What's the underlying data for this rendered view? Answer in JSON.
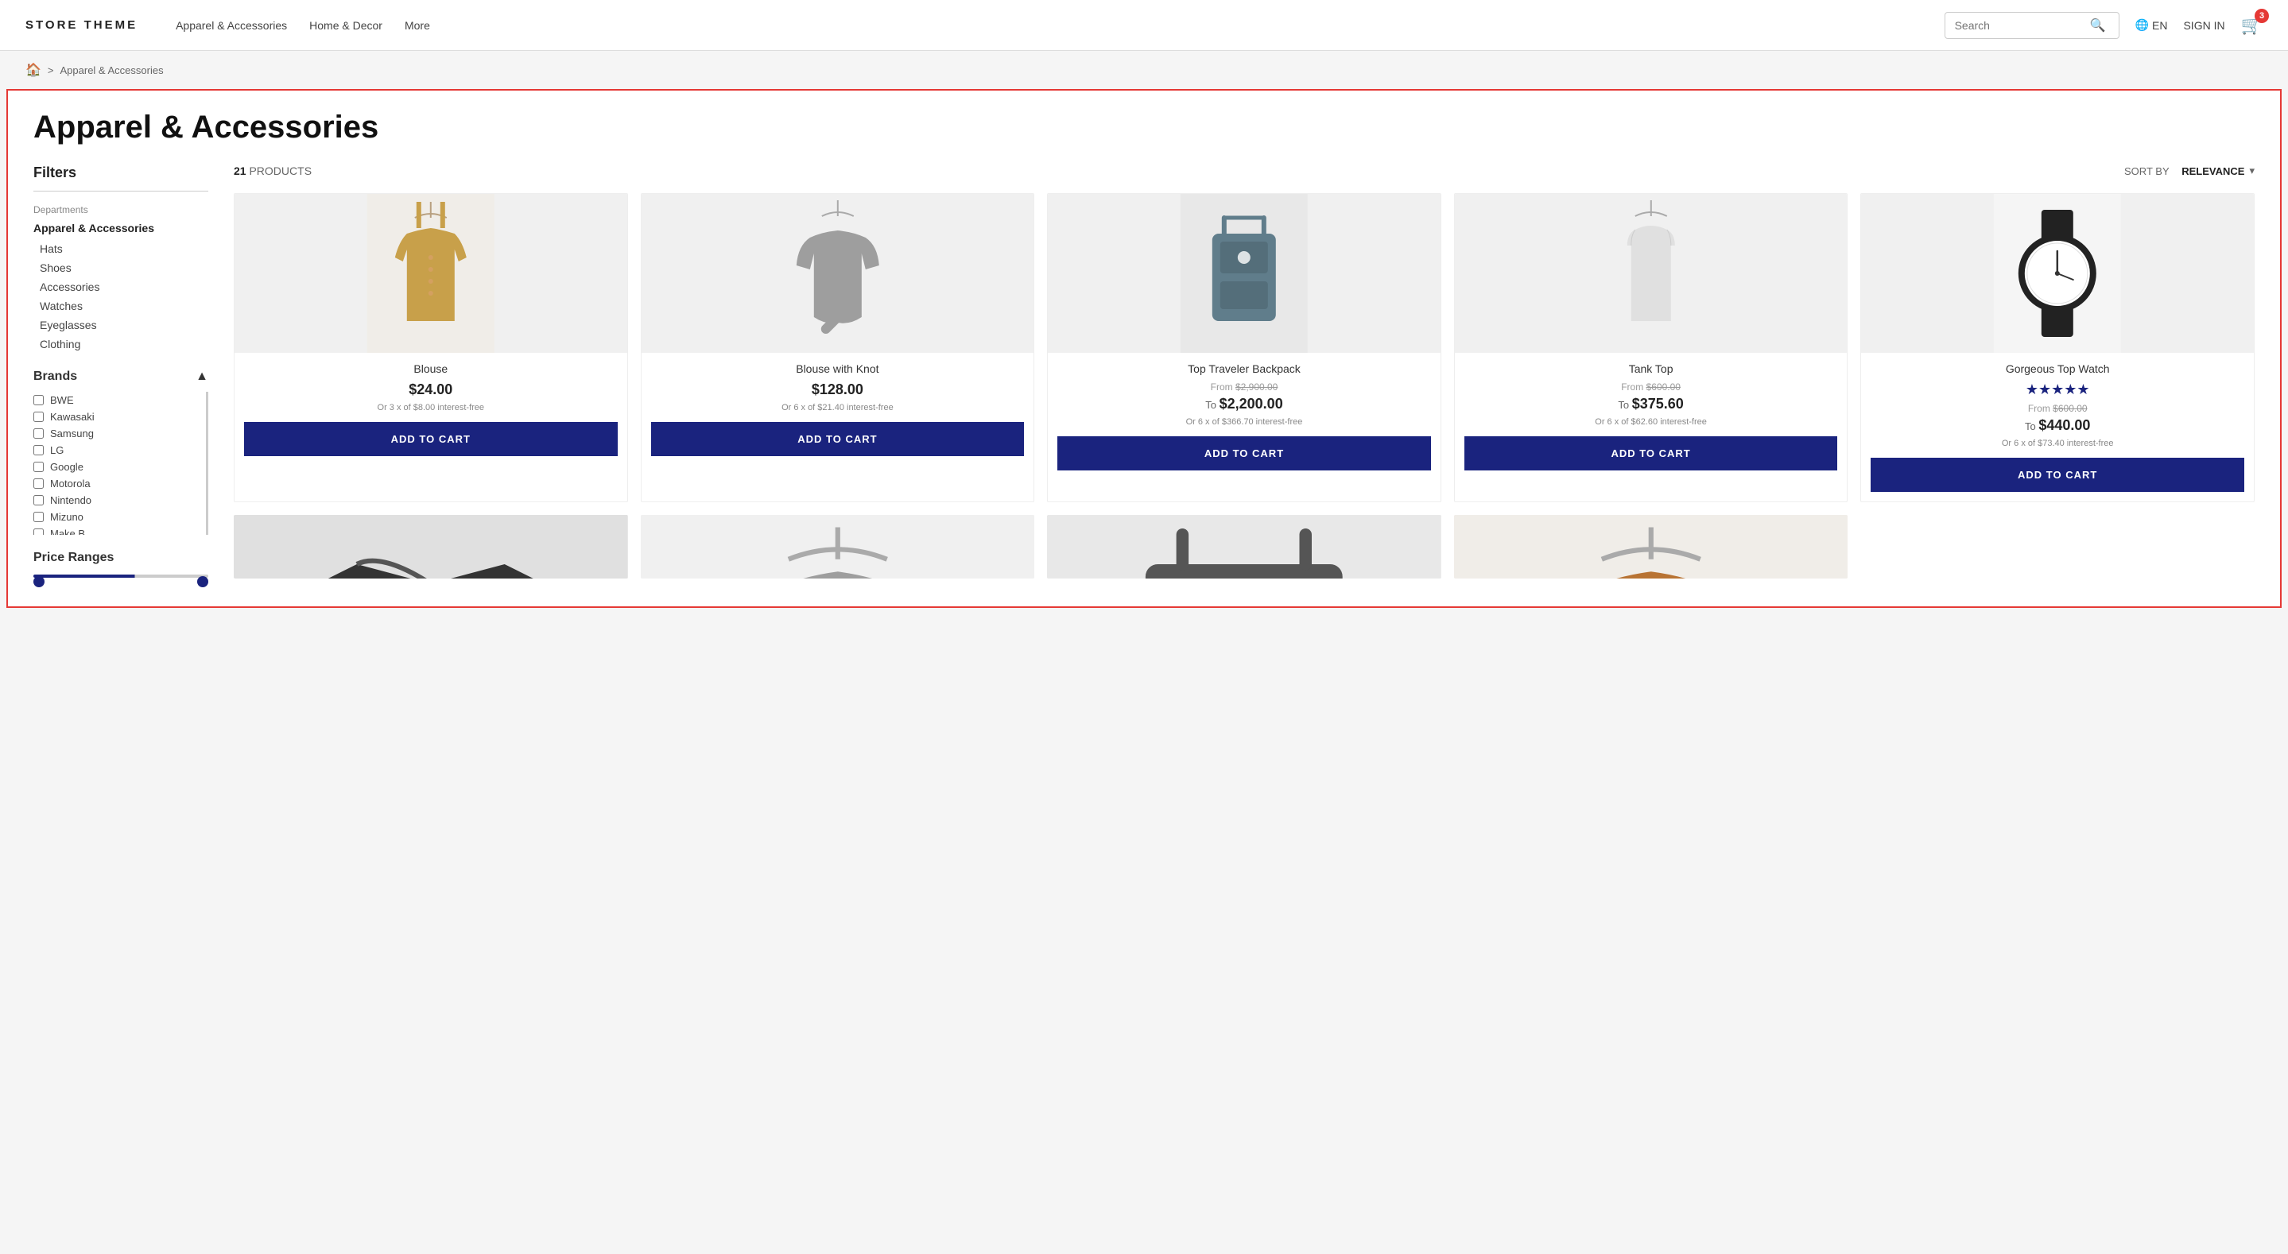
{
  "header": {
    "logo": "STORE THEME",
    "nav": [
      {
        "label": "Apparel & Accessories"
      },
      {
        "label": "Home & Decor"
      },
      {
        "label": "More"
      }
    ],
    "search_placeholder": "Search",
    "lang": "EN",
    "sign_in": "SIGN IN",
    "cart_count": "3"
  },
  "breadcrumb": {
    "home_icon": "home",
    "separator": ">",
    "current": "Apparel & Accessories"
  },
  "page": {
    "title": "Apparel & Accessories",
    "products_count": "21",
    "products_label": "PRODUCTS",
    "sort_by_label": "SORT BY",
    "sort_by_value": "RELEVANCE"
  },
  "filters": {
    "title": "Filters",
    "departments_label": "Departments",
    "main_category": "Apparel & Accessories",
    "categories": [
      {
        "label": "Hats"
      },
      {
        "label": "Shoes"
      },
      {
        "label": "Accessories"
      },
      {
        "label": "Watches"
      },
      {
        "label": "Eyeglasses"
      },
      {
        "label": "Clothing"
      }
    ],
    "brands_title": "Brands",
    "brands": [
      {
        "label": "BWE"
      },
      {
        "label": "Kawasaki"
      },
      {
        "label": "Samsung"
      },
      {
        "label": "LG"
      },
      {
        "label": "Google"
      },
      {
        "label": "Motorola"
      },
      {
        "label": "Nintendo"
      },
      {
        "label": "Mizuno"
      },
      {
        "label": "Make B."
      }
    ],
    "price_ranges_title": "Price Ranges"
  },
  "products": [
    {
      "name": "Blouse",
      "stars": null,
      "price": "$24.00",
      "from_label": null,
      "original_price": null,
      "to_price": null,
      "installment": "Or 3 x of $8.00 interest-free",
      "add_to_cart": "ADD TO CART",
      "color": "#c8a04a",
      "type": "blouse_brown"
    },
    {
      "name": "Blouse with Knot",
      "stars": null,
      "price": "$128.00",
      "from_label": null,
      "original_price": null,
      "to_price": null,
      "installment": "Or 6 x of $21.40 interest-free",
      "add_to_cart": "ADD TO CART",
      "color": "#9e9e9e",
      "type": "blouse_gray"
    },
    {
      "name": "Top Traveler Backpack",
      "stars": null,
      "price": null,
      "from_label": "From",
      "original_price": "$2,900.00",
      "to_price": "To $2,200.00",
      "installment": "Or 6 x of $366.70 interest-free",
      "add_to_cart": "ADD TO CART",
      "color": "#607d8b",
      "type": "backpack"
    },
    {
      "name": "Tank Top",
      "stars": null,
      "price": null,
      "from_label": "From",
      "original_price": "$600.00",
      "to_price": "To $375.60",
      "installment": "Or 6 x of $62.60 interest-free",
      "add_to_cart": "ADD TO CART",
      "color": "#e0e0e0",
      "type": "tank_top"
    },
    {
      "name": "Gorgeous Top Watch",
      "stars": "★★★★★",
      "price": null,
      "from_label": "From",
      "original_price": "$600.00",
      "to_price": "To $440.00",
      "installment": "Or 6 x of $73.40 interest-free",
      "add_to_cart": "ADD TO CART",
      "color": "#222",
      "type": "watch"
    }
  ],
  "partial_products": [
    {
      "color": "#333",
      "type": "dark_top"
    },
    {
      "color": "#9e9e9e",
      "type": "gray_top"
    },
    {
      "color": "#555",
      "type": "dark_bag"
    },
    {
      "color": "#5d4037",
      "type": "brown_top"
    }
  ]
}
